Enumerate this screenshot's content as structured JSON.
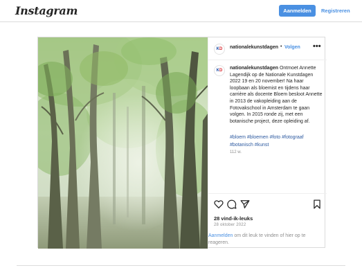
{
  "header": {
    "logo": "Instagram",
    "login_label": "Aanmelden",
    "signup_label": "Registreren"
  },
  "post": {
    "username": "nationalekunstdagen",
    "separator": "•",
    "follow_label": "Volgen",
    "more_label": "•••",
    "avatar_text_k": "K",
    "avatar_text_d": "D",
    "caption_username": "nationalekunstdagen",
    "caption_text": " Ontmoet Annette Lagendijk op de Nationale Kunstdagen 2022 19 en 20 november! Na haar loopbaan als bloemist en tijdens haar carrière als docente Bloem besloot Annette in 2013 de vakopleiding aan de Fotovakschool in Amsterdam te gaan volgen. In 2015 ronde zij, met een botanische project, deze opleiding af.",
    "hashtags": "#bloem #bloemen #foto #fotograaf #botanisch #kunst",
    "caption_age": "112 w.",
    "likes": "28 vind-ik-leuks",
    "date": "28 oktober 2022",
    "login_prompt_link": "Aanmelden",
    "login_prompt_text": " om dit leuk te vinden of hier op te reageren."
  },
  "colors": {
    "accent": "#4a90e2",
    "brand_blue": "#1f4fa8",
    "brand_red": "#d8262e"
  },
  "icons": [
    "heart-icon",
    "comment-icon",
    "share-icon",
    "bookmark-icon",
    "more-options-icon"
  ]
}
